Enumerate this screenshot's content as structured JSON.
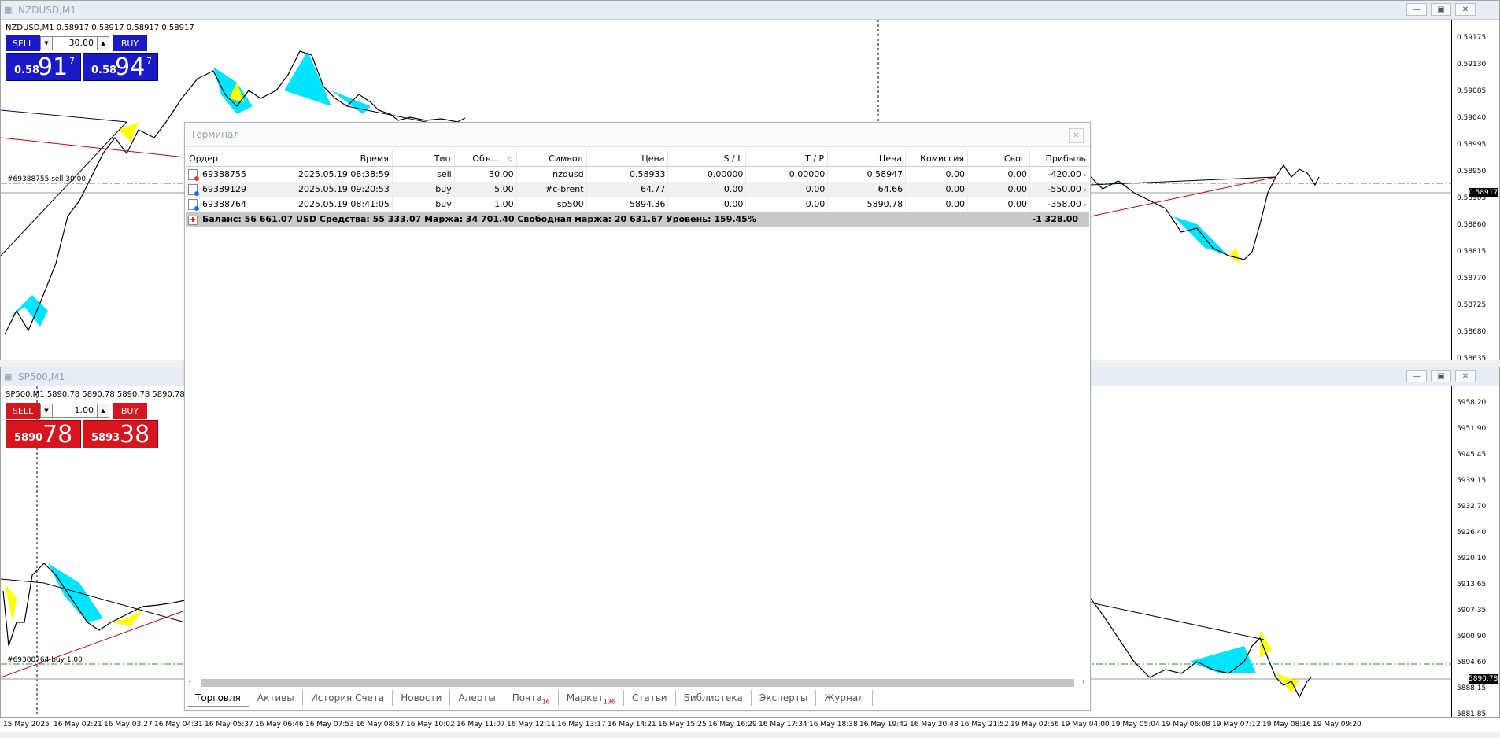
{
  "top_chart": {
    "title": "NZDUSD,M1",
    "ohlc": "NZDUSD,M1  0.58917 0.58917 0.58917 0.58917",
    "sell_label": "SELL",
    "buy_label": "BUY",
    "lot": "30.00",
    "bid_prefix": "0.58",
    "bid_big": "91",
    "bid_sup": "7",
    "ask_prefix": "0.58",
    "ask_big": "94",
    "ask_sup": "7",
    "order_line_label": "#69388755 sell 30.00",
    "current_price": "0.58917",
    "price_axis": [
      "0.59175",
      "0.59130",
      "0.59085",
      "0.59040",
      "0.58995",
      "0.58950",
      "0.58905",
      "0.58860",
      "0.58815",
      "0.58770",
      "0.58725",
      "0.58680",
      "0.58635"
    ]
  },
  "bottom_chart": {
    "title": "SP500,M1",
    "ohlc": "SP500,M1  5890.78 5890.78 5890.78 5890.78",
    "sell_label": "SELL",
    "buy_label": "BUY",
    "lot": "1.00",
    "bid_prefix": "5890",
    "bid_big": "78",
    "ask_prefix": "5893",
    "ask_big": "38",
    "order_line_label": "#69388764 buy 1.00",
    "current_price": "5890.78",
    "price_axis": [
      "5958.20",
      "5951.90",
      "5945.45",
      "5939.15",
      "5932.70",
      "5926.40",
      "5920.10",
      "5913.65",
      "5907.35",
      "5900.90",
      "5894.60",
      "5888.15",
      "5881.85"
    ]
  },
  "time_axis": [
    "15 May 2025",
    "16 May 02:21",
    "16 May 03:27",
    "16 May 04:31",
    "16 May 05:37",
    "16 May 06:46",
    "16 May 07:53",
    "16 May 08:57",
    "16 May 10:02",
    "16 May 11:07",
    "16 May 12:11",
    "16 May 13:17",
    "16 May 14:21",
    "16 May 15:25",
    "16 May 16:29",
    "16 May 17:34",
    "16 May 18:38",
    "16 May 19:42",
    "16 May 20:48",
    "16 May 21:52",
    "19 May 02:56",
    "19 May 04:00",
    "19 May 05:04",
    "19 May 06:08",
    "19 May 07:12",
    "19 May 08:16",
    "19 May 09:20"
  ],
  "terminal": {
    "title": "Терминал",
    "columns": [
      "Ордер",
      "Время",
      "Тип",
      "Объ...",
      "Символ",
      "Цена",
      "S / L",
      "T / P",
      "Цена",
      "Комиссия",
      "Своп",
      "Прибыль"
    ],
    "rows": [
      [
        "69388755",
        "2025.05.19 08:38:59",
        "sell",
        "30.00",
        "nzdusd",
        "0.58933",
        "0.00000",
        "0.00000",
        "0.58947",
        "0.00",
        "0.00",
        "-420.00"
      ],
      [
        "69389129",
        "2025.05.19 09:20:53",
        "buy",
        "5.00",
        "#c-brent",
        "64.77",
        "0.00",
        "0.00",
        "64.66",
        "0.00",
        "0.00",
        "-550.00"
      ],
      [
        "69388764",
        "2025.05.19 08:41:05",
        "buy",
        "1.00",
        "sp500",
        "5894.36",
        "0.00",
        "0.00",
        "5890.78",
        "0.00",
        "0.00",
        "-358.00"
      ]
    ],
    "balance_line": "Баланс: 56 661.07 USD  Средства: 55 333.07  Маржа: 34 701.40  Свободная маржа: 20 631.67  Уровень: 159.45%",
    "total_profit": "-1 328.00",
    "tabs": [
      {
        "label": "Торговля",
        "badge": ""
      },
      {
        "label": "Активы",
        "badge": ""
      },
      {
        "label": "История Счета",
        "badge": ""
      },
      {
        "label": "Новости",
        "badge": ""
      },
      {
        "label": "Алерты",
        "badge": ""
      },
      {
        "label": "Почта",
        "badge": "16"
      },
      {
        "label": "Маркет",
        "badge": "136"
      },
      {
        "label": "Статьи",
        "badge": ""
      },
      {
        "label": "Библиотека",
        "badge": ""
      },
      {
        "label": "Эксперты",
        "badge": ""
      },
      {
        "label": "Журнал",
        "badge": ""
      }
    ]
  },
  "icons": {
    "minimize": "minimize-icon",
    "restore": "restore-icon",
    "close": "close-icon"
  },
  "colors": {
    "sell_blue": "#1a1ac8",
    "sell_red": "#d8141e",
    "pattern_cyan": "#00e5ff",
    "pattern_yellow": "#ffff00",
    "order_line": "#2e8b2e"
  }
}
